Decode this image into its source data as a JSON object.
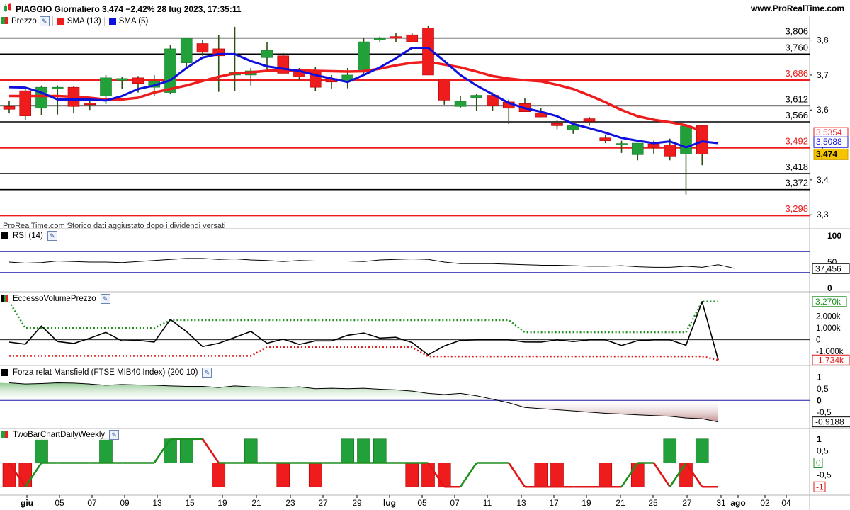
{
  "header": {
    "title": "PIAGGIO Giornaliero 3,474 −2,42% 28 lug 2023, 17:35:11",
    "site": "www.ProRealTime.com"
  },
  "colors": {
    "up": "#22a03a",
    "down": "#ee1c1c",
    "sma13": "#ee1c1c",
    "sma5": "#1010dd"
  },
  "price_legend": {
    "price": "Prezzo",
    "sma13": "SMA (13)",
    "sma5": "SMA (5)"
  },
  "watermark": "ProRealTime.com  Storico dati aggiustato dopo i dividendi versati",
  "price_axis_ticks": [
    "3,8",
    "3,7",
    "3,6",
    "3,5",
    "3,4",
    "3,3"
  ],
  "levels": [
    {
      "label": "3,806",
      "color": "#000000"
    },
    {
      "label": "3,760",
      "color": "#000000"
    },
    {
      "label": "3,686",
      "color": "#ee1c1c"
    },
    {
      "label": "3,612",
      "color": "#000000"
    },
    {
      "label": "3,566",
      "color": "#000000"
    },
    {
      "label": "3,492",
      "color": "#ee1c1c"
    },
    {
      "label": "3,418",
      "color": "#000000"
    },
    {
      "label": "3,372",
      "color": "#000000"
    },
    {
      "label": "3,298",
      "color": "#ee1c1c"
    }
  ],
  "badges": {
    "sma13": "3,5354",
    "sma5": "3,5088",
    "last": "3,474"
  },
  "x_axis_labels": [
    "giu",
    "05",
    "07",
    "09",
    "13",
    "15",
    "19",
    "21",
    "23",
    "27",
    "29",
    "lug",
    "05",
    "07",
    "11",
    "13",
    "17",
    "19",
    "21",
    "25",
    "27",
    "31",
    "ago",
    "02",
    "04"
  ],
  "panels": {
    "rsi": {
      "label": "RSI (14)",
      "ticks": [
        "100",
        "50",
        "0"
      ],
      "value": "37,456"
    },
    "evp": {
      "label": "EccessoVolumePrezzo",
      "ticks": [
        "2.000k",
        "1.000k",
        "0",
        "-1.000k"
      ],
      "upper": "3.270k",
      "lower": "-1.734k"
    },
    "mansfield": {
      "label": "Forza relat Mansfield (FTSE MIB40 Index) (200 10)",
      "ticks": [
        "1",
        "0,5",
        "0",
        "-0,5"
      ],
      "value": "-0,9188"
    },
    "twobar": {
      "label": "TwoBarChartDailyWeekly",
      "ticks": [
        "1",
        "0,5",
        "0",
        "-0,5",
        "-1"
      ],
      "value0": "0",
      "valueNeg": "-1"
    }
  },
  "chart_data": [
    {
      "type": "candlestick",
      "title": "PIAGGIO Giornaliero",
      "ylim": [
        3.27,
        3.86
      ],
      "candles": [
        {
          "o": 3.61,
          "h": 3.625,
          "l": 3.59,
          "c": 3.602
        },
        {
          "o": 3.655,
          "h": 3.66,
          "l": 3.572,
          "c": 3.583
        },
        {
          "o": 3.605,
          "h": 3.67,
          "l": 3.585,
          "c": 3.665
        },
        {
          "o": 3.66,
          "h": 3.67,
          "l": 3.587,
          "c": 3.665
        },
        {
          "o": 3.665,
          "h": 3.668,
          "l": 3.59,
          "c": 3.61
        },
        {
          "o": 3.62,
          "h": 3.63,
          "l": 3.6,
          "c": 3.615
        },
        {
          "o": 3.64,
          "h": 3.7,
          "l": 3.617,
          "c": 3.692
        },
        {
          "o": 3.685,
          "h": 3.695,
          "l": 3.66,
          "c": 3.69
        },
        {
          "o": 3.692,
          "h": 3.697,
          "l": 3.65,
          "c": 3.676
        },
        {
          "o": 3.665,
          "h": 3.7,
          "l": 3.64,
          "c": 3.682
        },
        {
          "o": 3.65,
          "h": 3.785,
          "l": 3.645,
          "c": 3.775
        },
        {
          "o": 3.735,
          "h": 3.805,
          "l": 3.72,
          "c": 3.805
        },
        {
          "o": 3.79,
          "h": 3.8,
          "l": 3.755,
          "c": 3.765
        },
        {
          "o": 3.775,
          "h": 3.815,
          "l": 3.652,
          "c": 3.755
        },
        {
          "o": 3.7,
          "h": 3.838,
          "l": 3.655,
          "c": 3.708
        },
        {
          "o": 3.7,
          "h": 3.72,
          "l": 3.67,
          "c": 3.712
        },
        {
          "o": 3.75,
          "h": 3.795,
          "l": 3.715,
          "c": 3.77
        },
        {
          "o": 3.755,
          "h": 3.763,
          "l": 3.705,
          "c": 3.705
        },
        {
          "o": 3.712,
          "h": 3.72,
          "l": 3.685,
          "c": 3.695
        },
        {
          "o": 3.71,
          "h": 3.722,
          "l": 3.655,
          "c": 3.665
        },
        {
          "o": 3.69,
          "h": 3.7,
          "l": 3.66,
          "c": 3.68
        },
        {
          "o": 3.682,
          "h": 3.72,
          "l": 3.662,
          "c": 3.7
        },
        {
          "o": 3.715,
          "h": 3.805,
          "l": 3.7,
          "c": 3.795
        },
        {
          "o": 3.8,
          "h": 3.81,
          "l": 3.795,
          "c": 3.805
        },
        {
          "o": 3.81,
          "h": 3.82,
          "l": 3.795,
          "c": 3.805
        },
        {
          "o": 3.815,
          "h": 3.82,
          "l": 3.795,
          "c": 3.795
        },
        {
          "o": 3.835,
          "h": 3.842,
          "l": 3.7,
          "c": 3.7
        },
        {
          "o": 3.688,
          "h": 3.69,
          "l": 3.615,
          "c": 3.628
        },
        {
          "o": 3.61,
          "h": 3.64,
          "l": 3.605,
          "c": 3.625
        },
        {
          "o": 3.635,
          "h": 3.645,
          "l": 3.597,
          "c": 3.642
        },
        {
          "o": 3.642,
          "h": 3.65,
          "l": 3.597,
          "c": 3.613
        },
        {
          "o": 3.623,
          "h": 3.63,
          "l": 3.56,
          "c": 3.605
        },
        {
          "o": 3.618,
          "h": 3.635,
          "l": 3.598,
          "c": 3.595
        },
        {
          "o": 3.592,
          "h": 3.605,
          "l": 3.58,
          "c": 3.58
        },
        {
          "o": 3.562,
          "h": 3.57,
          "l": 3.545,
          "c": 3.555
        },
        {
          "o": 3.543,
          "h": 3.563,
          "l": 3.532,
          "c": 3.555
        },
        {
          "o": 3.575,
          "h": 3.58,
          "l": 3.555,
          "c": 3.567
        },
        {
          "o": 3.52,
          "h": 3.53,
          "l": 3.505,
          "c": 3.512
        },
        {
          "o": 3.5,
          "h": 3.512,
          "l": 3.477,
          "c": 3.504
        },
        {
          "o": 3.472,
          "h": 3.5,
          "l": 3.456,
          "c": 3.505
        },
        {
          "o": 3.503,
          "h": 3.512,
          "l": 3.475,
          "c": 3.493
        },
        {
          "o": 3.5,
          "h": 3.518,
          "l": 3.456,
          "c": 3.468
        },
        {
          "o": 3.474,
          "h": 3.556,
          "l": 3.358,
          "c": 3.554
        },
        {
          "o": 3.555,
          "h": 3.557,
          "l": 3.442,
          "c": 3.474
        }
      ],
      "sma13": [
        3.64,
        3.64,
        3.64,
        3.64,
        3.638,
        3.635,
        3.63,
        3.63,
        3.635,
        3.65,
        3.66,
        3.67,
        3.683,
        3.695,
        3.705,
        3.708,
        3.712,
        3.714,
        3.713,
        3.712,
        3.711,
        3.71,
        3.711,
        3.718,
        3.728,
        3.735,
        3.738,
        3.73,
        3.722,
        3.71,
        3.697,
        3.69,
        3.685,
        3.682,
        3.672,
        3.66,
        3.642,
        3.622,
        3.6,
        3.582,
        3.572,
        3.565,
        3.556,
        3.54
      ],
      "sma5": [
        3.665,
        3.664,
        3.65,
        3.63,
        3.63,
        3.63,
        3.627,
        3.64,
        3.66,
        3.67,
        3.685,
        3.72,
        3.75,
        3.76,
        3.76,
        3.74,
        3.725,
        3.718,
        3.712,
        3.7,
        3.69,
        3.68,
        3.7,
        3.722,
        3.748,
        3.778,
        3.778,
        3.74,
        3.7,
        3.67,
        3.645,
        3.62,
        3.605,
        3.595,
        3.582,
        3.56,
        3.548,
        3.535,
        3.52,
        3.512,
        3.505,
        3.51,
        3.493,
        3.51,
        3.505
      ]
    },
    {
      "type": "line",
      "title": "RSI (14)",
      "ylim": [
        0,
        100
      ],
      "values": [
        50,
        48,
        49,
        52,
        51,
        50,
        50,
        49,
        51,
        53,
        55,
        57,
        57,
        55,
        56,
        54,
        53,
        51,
        53,
        52,
        52,
        52,
        51,
        54,
        55,
        56,
        55,
        50,
        47,
        47,
        47,
        46,
        45,
        44,
        44,
        43,
        42,
        42,
        43,
        41,
        40,
        40,
        42,
        40,
        45,
        38
      ]
    },
    {
      "type": "line",
      "title": "EccessoVolumePrezzo",
      "ylim": [
        -1900,
        3500
      ],
      "values": [
        -200,
        -380,
        1180,
        -150,
        -320,
        130,
        630,
        -100,
        -50,
        -200,
        1740,
        700,
        -580,
        -300,
        200,
        720,
        -300,
        60,
        -400,
        -100,
        -100,
        380,
        580,
        140,
        210,
        -240,
        -1300,
        -530,
        -50,
        -10,
        -10,
        -10,
        -190,
        -200,
        -10,
        -150,
        -10,
        -10,
        -490,
        -80,
        -10,
        -10,
        -470,
        3270,
        -1734
      ],
      "upper_band": [
        3270,
        1000,
        1000,
        1000,
        1000,
        1000,
        1000,
        1000,
        1000,
        1000,
        1680,
        1680,
        1680,
        1680,
        1680,
        1680,
        1680,
        1680,
        1680,
        1680,
        1680,
        1680,
        1680,
        1680,
        1680,
        1680,
        1680,
        1680,
        1680,
        1680,
        1680,
        1680,
        640,
        640,
        640,
        640,
        640,
        640,
        640,
        640,
        640,
        640,
        640,
        3270,
        3270
      ],
      "lower_band": [
        -1380,
        -1380,
        -1380,
        -1380,
        -1380,
        -1380,
        -1380,
        -1380,
        -1380,
        -1380,
        -1380,
        -1380,
        -1380,
        -1380,
        -1380,
        -1380,
        -650,
        -650,
        -650,
        -650,
        -650,
        -650,
        -650,
        -650,
        -650,
        -650,
        -1420,
        -1420,
        -1420,
        -1420,
        -1420,
        -1420,
        -1420,
        -1420,
        -1420,
        -1420,
        -1420,
        -1420,
        -1420,
        -1420,
        -1420,
        -1420,
        -1420,
        -1420,
        -1734
      ]
    },
    {
      "type": "area",
      "title": "Forza relat Mansfield (FTSE MIB40 Index) (200 10)",
      "ylim": [
        -1.05,
        1.25
      ],
      "values": [
        0.75,
        0.7,
        0.72,
        0.75,
        0.74,
        0.7,
        0.65,
        0.68,
        0.66,
        0.65,
        0.62,
        0.6,
        0.6,
        0.55,
        0.62,
        0.58,
        0.57,
        0.55,
        0.58,
        0.5,
        0.52,
        0.5,
        0.52,
        0.48,
        0.45,
        0.4,
        0.3,
        0.25,
        0.3,
        0.2,
        0.05,
        -0.1,
        -0.3,
        -0.35,
        -0.4,
        -0.45,
        -0.5,
        -0.55,
        -0.58,
        -0.62,
        -0.65,
        -0.68,
        -0.75,
        -0.78,
        -0.92
      ]
    },
    {
      "type": "bar",
      "title": "TwoBarChartDailyWeekly",
      "ylim": [
        -1.2,
        1.2
      ],
      "bars": [
        -1,
        -1,
        1,
        0,
        0,
        0,
        1,
        0,
        0,
        0,
        1,
        1,
        0,
        -1,
        0,
        1,
        0,
        -1,
        0,
        -1,
        0,
        1,
        1,
        1,
        0,
        -1,
        -1,
        -1,
        0,
        0,
        0,
        0,
        0,
        -1,
        -1,
        0,
        0,
        -1,
        0,
        -1,
        0,
        1,
        -1,
        1,
        0
      ],
      "signal": [
        0,
        -1,
        0,
        0,
        0,
        0,
        0,
        0,
        0,
        0,
        1,
        1,
        1,
        0,
        0,
        0,
        0,
        0,
        0,
        0,
        0,
        0,
        0,
        0,
        0,
        0,
        0,
        -1,
        -1,
        0,
        0,
        0,
        -1,
        -1,
        -1,
        -1,
        -1,
        -1,
        -1,
        0,
        0,
        -1,
        0,
        -1,
        -1
      ]
    }
  ]
}
